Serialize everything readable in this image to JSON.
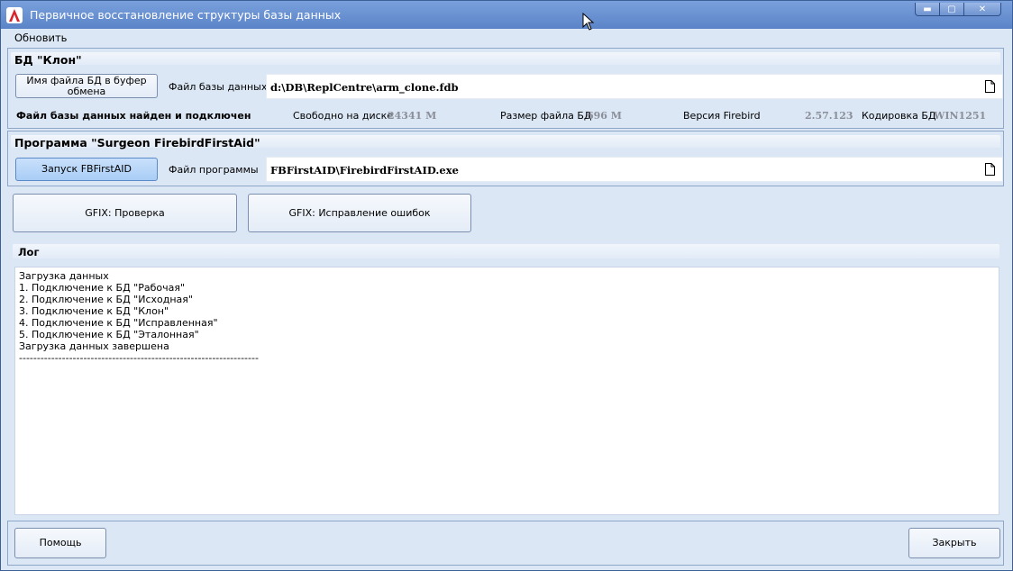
{
  "window": {
    "title": "Первичное восстановление структуры базы данных",
    "app_icon": "app-logo-icon"
  },
  "menu": {
    "refresh": "Обновить"
  },
  "clone_group": {
    "title": "БД \"Клон\"",
    "copy_button": "Имя файла БД в буфер обмена",
    "file_label": "Файл базы данных",
    "file_value": "d:\\DB\\ReplCentre\\arm_clone.fdb",
    "status": "Файл базы данных найден и подключен",
    "free_label": "Свободно на диске",
    "free_value": "24341 М",
    "size_label": "Размер файла  БД",
    "size_value": "696 М",
    "version_label": "Версия Firebird",
    "version_value": "2.57.123",
    "encoding_label": "Кодировка БД",
    "encoding_value": "WIN1251"
  },
  "program_group": {
    "title": "Программа \"Surgeon FirebirdFirstAid\"",
    "run_button": "Запуск FBFirstAID",
    "file_label": "Файл программы",
    "file_value": "FBFirstAID\\FirebirdFirstAID.exe"
  },
  "actions": {
    "check": "GFIX:  Проверка",
    "fix": "GFIX:  Исправление ошибок"
  },
  "log": {
    "title": "Лог",
    "lines": [
      "Загрузка данных",
      "1. Подключение к БД \"Рабочая\"",
      "2. Подключение к БД \"Исходная\"",
      "3. Подключение к БД \"Клон\"",
      "4. Подключение к БД \"Исправленная\"",
      "5. Подключение к БД \"Эталонная\"",
      "Загрузка данных завершена",
      "-------------------------------------------------------------------"
    ]
  },
  "footer": {
    "help": "Помощь",
    "close": "Закрыть"
  },
  "colors": {
    "titlebar": "#5b84c8",
    "window_bg": "#dce7f5",
    "button_active": "#a9cdf6"
  }
}
